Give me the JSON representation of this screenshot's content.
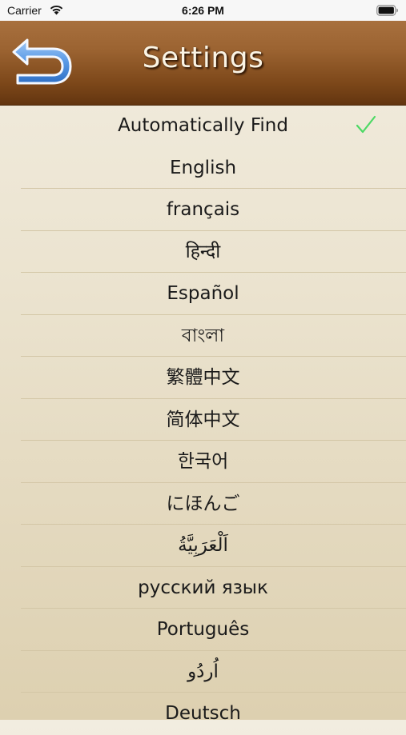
{
  "status_bar": {
    "carrier": "Carrier",
    "time": "6:26 PM"
  },
  "nav": {
    "title": "Settings",
    "back_icon": "back-arrow-icon"
  },
  "colors": {
    "nav_top": "#a8703e",
    "nav_bottom": "#633510",
    "back_icon": "#4a8de0",
    "check": "#4cd964",
    "background": "#ebe3cf"
  },
  "languages": {
    "selected": "Automatically Find",
    "items": [
      {
        "label": "Automatically Find"
      },
      {
        "label": "English"
      },
      {
        "label": "français"
      },
      {
        "label": "हिन्दी"
      },
      {
        "label": "Español"
      },
      {
        "label": "বাংলা"
      },
      {
        "label": "繁體中文"
      },
      {
        "label": "简体中文"
      },
      {
        "label": "한국어"
      },
      {
        "label": "にほんご"
      },
      {
        "label": "اَلْعَرَبِيَّةُ"
      },
      {
        "label": "русский язык"
      },
      {
        "label": "Português"
      },
      {
        "label": "اُردُو"
      },
      {
        "label": "Deutsch"
      }
    ]
  }
}
